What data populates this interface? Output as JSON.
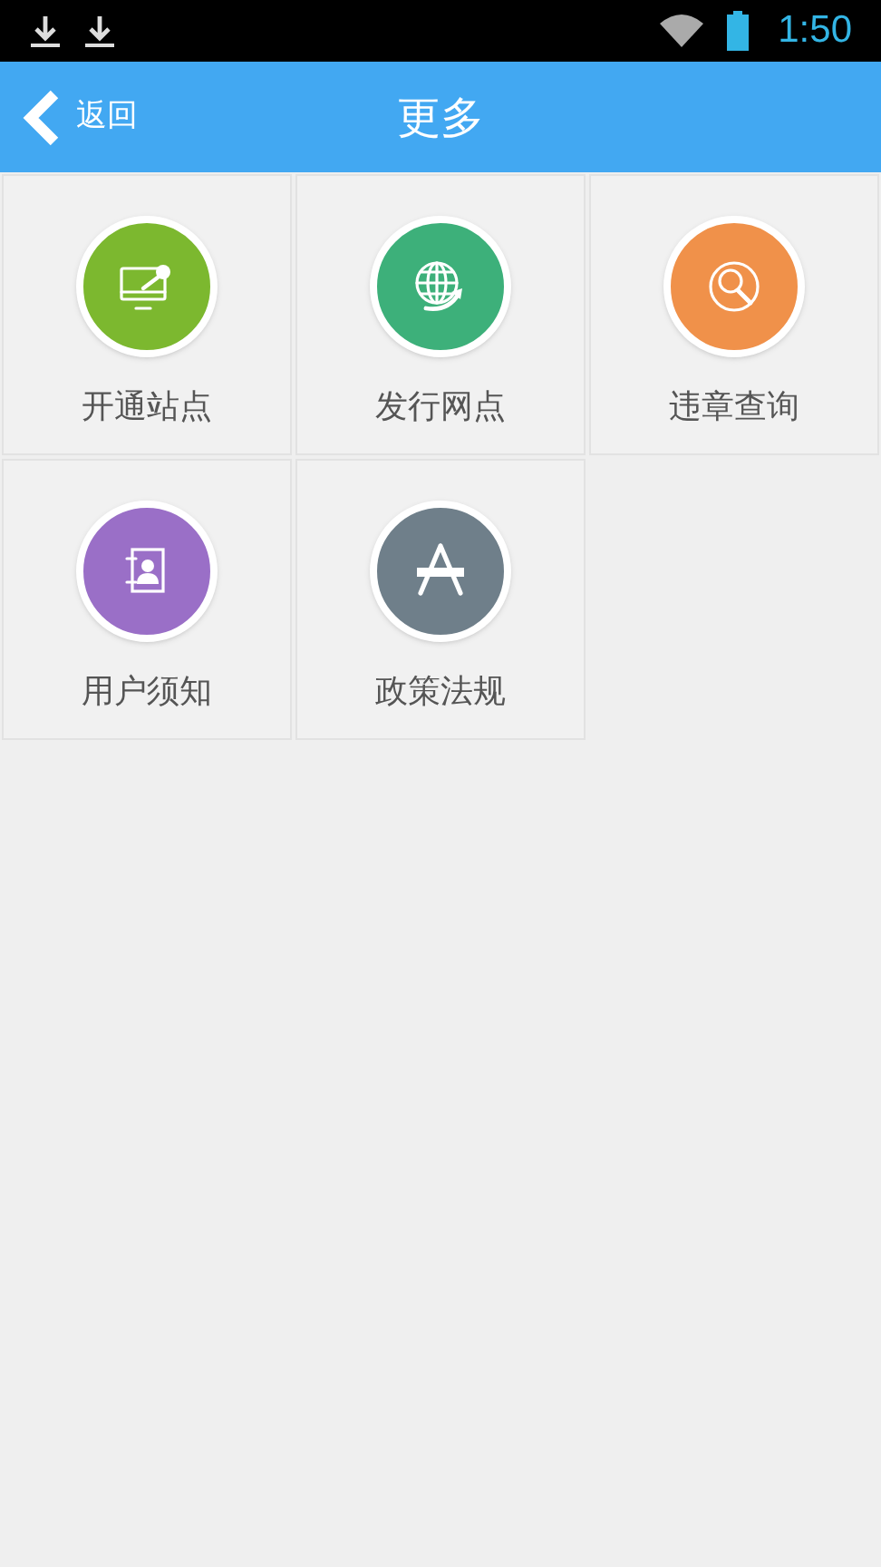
{
  "status_bar": {
    "time": "1:50"
  },
  "header": {
    "back": "返回",
    "title": "更多"
  },
  "tiles": [
    {
      "label": "开通站点",
      "kind": "monitor",
      "color": "#7cb82f"
    },
    {
      "label": "发行网点",
      "kind": "globe",
      "color": "#3db07a"
    },
    {
      "label": "违章查询",
      "kind": "search",
      "color": "#f0914a"
    },
    {
      "label": "用户须知",
      "kind": "contact",
      "color": "#9a6fc7"
    },
    {
      "label": "政策法规",
      "kind": "tools",
      "color": "#6f7f8a"
    }
  ]
}
